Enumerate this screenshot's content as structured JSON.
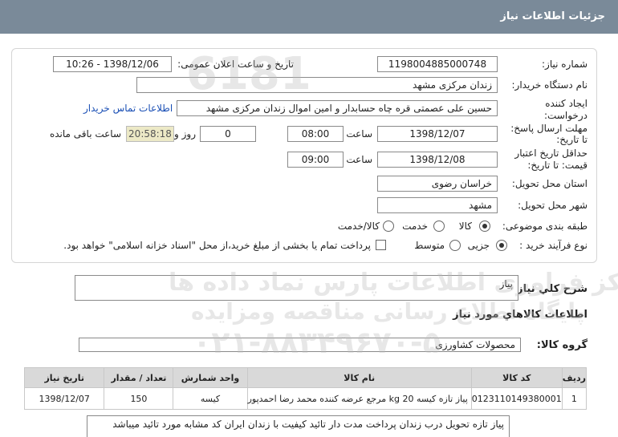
{
  "header": {
    "title": "جزئیات اطلاعات نیاز"
  },
  "form": {
    "need_number_label": "شماره نیاز:",
    "need_number": "1198004885000748",
    "announce_label": "تاریخ و ساعت اعلان عمومی:",
    "announce_value": "1398/12/06 - 10:26",
    "buyer_org_label": "نام دستگاه خریدار:",
    "buyer_org": "زندان مرکزی مشهد",
    "requester_label_1": "ایجاد کننده",
    "requester_label_2": "درخواست:",
    "requester": "حسین علی عصمتی قره چاه حسابدار و امین اموال زندان مرکزی مشهد",
    "contact_link": "اطلاعات تماس خریدار",
    "deadline_label_1": "مهلت ارسال پاسخ:",
    "deadline_label_2": "تا تاریخ:",
    "deadline_date": "1398/12/07",
    "time_label": "ساعت",
    "deadline_time": "08:00",
    "days_value": "0",
    "days_label": "روز و",
    "remaining_time": "20:58:18",
    "remaining_label": "ساعت باقی مانده",
    "validity_label_1": "حداقل تاریخ اعتبار",
    "validity_label_2": "قیمت: تا تاریخ:",
    "validity_date": "1398/12/08",
    "validity_time": "09:00",
    "province_label": "استان محل تحویل:",
    "province": "خراسان رضوی",
    "city_label": "شهر محل تحویل:",
    "city": "مشهد",
    "category_label": "طبقه بندی موضوعی:",
    "category_options": [
      "کالا",
      "خدمت",
      "کالا/خدمت"
    ],
    "purchase_label": "نوع فرآیند خرید :",
    "purchase_options": [
      "جزیی",
      "متوسط"
    ],
    "treasury_note": "پرداخت تمام یا بخشی از مبلغ خرید،از محل \"اسناد خزانه اسلامی\" خواهد بود."
  },
  "summary": {
    "desc_label": "شرح کلي نياز:",
    "desc_value": "پیاز",
    "goods_info_title": "اطلاعات کالاهاي مورد نياز",
    "group_label": "گروه کالا:",
    "group_value": "محصولات کشاورزی"
  },
  "table": {
    "headers": [
      "ردیف",
      "کد کالا",
      "نام کالا",
      "واحد شمارش",
      "تعداد / مقدار",
      "تاریخ نیاز"
    ],
    "rows": [
      [
        "1",
        "0123110149380001",
        "پیاز تازه کیسه 20 kg مرجع عرضه کننده محمد رضا احمدپور",
        "کیسه",
        "150",
        "1398/12/07"
      ]
    ]
  },
  "note": "پیاز تازه تحویل درب زندان پرداخت مدت دار  تائید کیفیت با زندان ایران کد مشابه مورد تائید میباشد",
  "watermark": {
    "line1": "مرکز فراوری اطلاعات پارس نماد داده ها",
    "line2": "پایگاه اطلاع رسانی مناقصه ومزایده",
    "line3": "۰۲۱-۸۸۳۴۹۶۷۰-۵"
  },
  "colors": {
    "titlebar": "#7a8a99",
    "remaining_bg": "#ece9c6",
    "link": "#1a4fb5"
  }
}
